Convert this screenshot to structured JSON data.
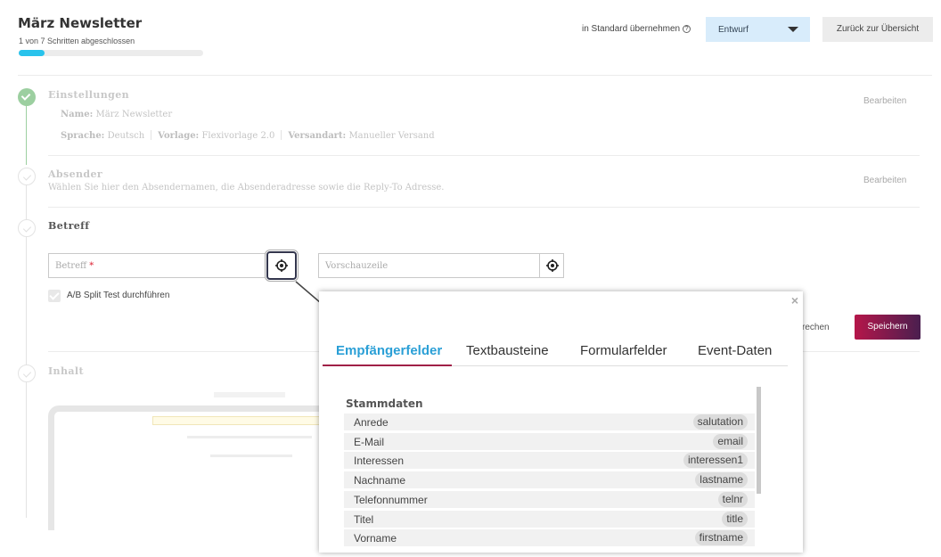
{
  "header": {
    "title": "März Newsletter",
    "progress_text": "1 von 7 Schritten abgeschlossen",
    "progress_fraction": 0.14,
    "standard_label": "in Standard übernehmen",
    "help_glyph": "?",
    "status_select": "Entwurf",
    "back_button": "Zurück zur Übersicht"
  },
  "steps": {
    "settings": {
      "title": "Einstellungen",
      "name_label": "Name:",
      "name_value": "März Newsletter",
      "lang_label": "Sprache:",
      "lang_value": "Deutsch",
      "tpl_label": "Vorlage:",
      "tpl_value": "Flexivorlage 2.0",
      "ship_label": "Versandart:",
      "ship_value": "Manueller Versand",
      "edit": "Bearbeiten"
    },
    "sender": {
      "title": "Absender",
      "desc": "Wählen Sie hier den Absendernamen, die Absenderadresse sowie die Reply-To Adresse.",
      "edit": "Bearbeiten"
    },
    "subject": {
      "title": "Betreff",
      "subject_placeholder": "Betreff",
      "required_mark": "*",
      "preview_placeholder": "Vorschauzeile",
      "ab_label": "A/B Split Test durchführen",
      "cancel": "rechen",
      "save": "Speichern"
    },
    "content": {
      "title": "Inhalt"
    }
  },
  "popup": {
    "close": "×",
    "tabs": [
      "Empfängerfelder",
      "Textbausteine",
      "Formularfelder",
      "Event-Daten"
    ],
    "group": "Stammdaten",
    "rows": [
      {
        "label": "Anrede",
        "code": "salutation"
      },
      {
        "label": "E-Mail",
        "code": "email"
      },
      {
        "label": "Interessen",
        "code": "interessen1"
      },
      {
        "label": "Nachname",
        "code": "lastname"
      },
      {
        "label": "Telefonnummer",
        "code": "telnr"
      },
      {
        "label": "Titel",
        "code": "title"
      },
      {
        "label": "Vorname",
        "code": "firstname"
      }
    ]
  },
  "colors": {
    "accent": "#29c3ec",
    "tab_active": "#2a9fd6",
    "save_gradient_start": "#b5164a",
    "save_gradient_end": "#4a1f4f",
    "done_step": "#9ccfa0"
  },
  "icons": [
    "help-icon",
    "chevron-down-icon",
    "check-icon",
    "placeholder-target-icon",
    "close-icon"
  ]
}
